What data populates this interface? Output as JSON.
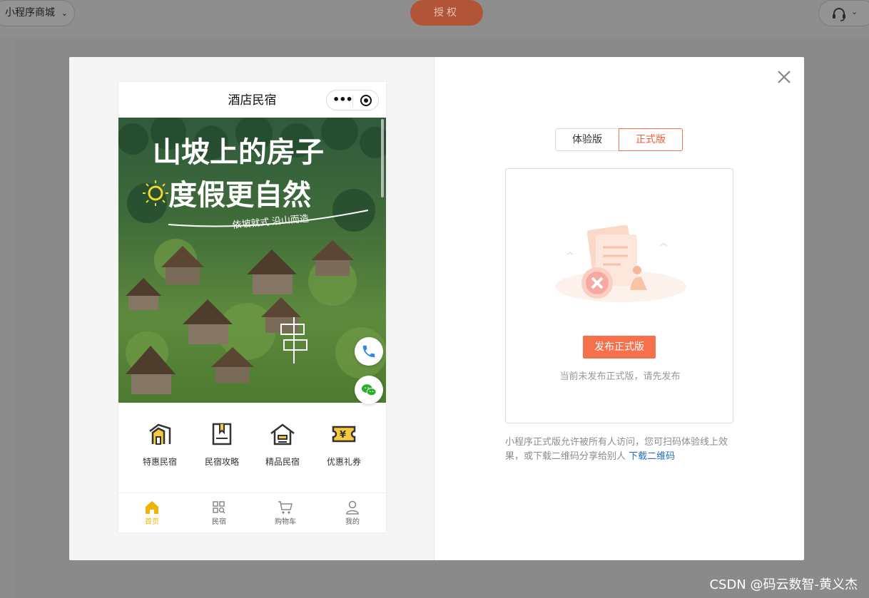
{
  "topbar": {
    "app_select": "小程序商城",
    "auth_button": "授权"
  },
  "modal": {
    "phone": {
      "title": "酒店民宿",
      "quick_nav": [
        {
          "label": "特惠民宿",
          "icon": "villa-icon"
        },
        {
          "label": "民宿攻略",
          "icon": "guide-book-icon"
        },
        {
          "label": "精品民宿",
          "icon": "house-icon"
        },
        {
          "label": "优惠礼券",
          "icon": "coupon-icon"
        }
      ],
      "tabs": [
        {
          "label": "首页",
          "icon": "home-icon",
          "active": true
        },
        {
          "label": "民宿",
          "icon": "grid-search-icon",
          "active": false
        },
        {
          "label": "购物车",
          "icon": "cart-icon",
          "active": false
        },
        {
          "label": "我的",
          "icon": "user-icon",
          "active": false
        }
      ],
      "banner": {
        "headline_1": "山坡上的房子",
        "headline_2": "度假更自然",
        "tagline": "依坡就式  沿山而造"
      }
    },
    "version_tabs": {
      "experience": "体验版",
      "official": "正式版",
      "selected": "正式版"
    },
    "card": {
      "publish_button": "发布正式版",
      "hint": "当前未发布正式版，请先发布"
    },
    "description": {
      "text": "小程序正式版允许被所有人访问，您可扫码体验线上效果，或下载二维码分享给别人",
      "link": "下载二维码"
    }
  },
  "watermark": "CSDN @码云数智-黄义杰",
  "colors": {
    "accent": "#f7704c",
    "tab_active": "#f1b300",
    "link": "#1f6fc4"
  }
}
